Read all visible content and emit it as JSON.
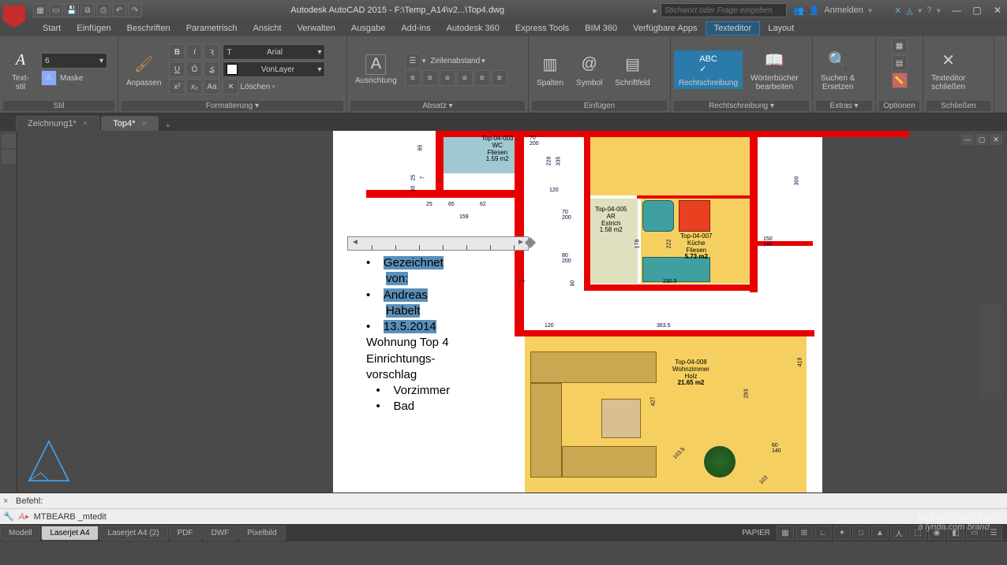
{
  "titlebar": {
    "app_title": "Autodesk AutoCAD 2015 - F:\\Temp_A14\\v2...\\Top4.dwg",
    "search_placeholder": "Stichwort oder Frage eingeben",
    "signin": "Anmelden"
  },
  "menu": {
    "items": [
      "Start",
      "Einfügen",
      "Beschriften",
      "Parametrisch",
      "Ansicht",
      "Verwalten",
      "Ausgabe",
      "Add-ins",
      "Autodesk 360",
      "Express Tools",
      "BIM 360",
      "Verfügbare Apps",
      "Texteditor",
      "Layout"
    ],
    "active_index": 12
  },
  "ribbon": {
    "stil": {
      "label": "Stil",
      "textstil": "Text-\nstil",
      "height": "6",
      "mask": "Maske"
    },
    "formatierung": {
      "label": "Formatierung ▾",
      "anpassen": "Anpassen",
      "font": "Arial",
      "layer": "VonLayer",
      "loeschen": "Löschen"
    },
    "absatz": {
      "label": "Absatz ▾",
      "ausrichtung": "Ausrichtung",
      "zeilenabstand": "Zeilenabstand"
    },
    "einfuegen": {
      "label": "Einfügen",
      "spalten": "Spalten",
      "symbol": "Symbol",
      "schriftfeld": "Schriftfeld"
    },
    "rechtschreibung": {
      "label": "Rechtschreibung ▾",
      "rs": "Rechtschreibung",
      "woerterbuecher": "Wörterbücher\nbearbeiten"
    },
    "extras": {
      "label": "Extras ▾",
      "suchen": "Suchen &\nErsetzen"
    },
    "optionen": {
      "label": "Optionen"
    },
    "schliessen": {
      "label": "Schließen",
      "texteditor": "Texteditor\nschließen"
    }
  },
  "doc_tabs": {
    "tabs": [
      {
        "label": "Zeichnung1*",
        "active": false
      },
      {
        "label": "Top4*",
        "active": true
      }
    ]
  },
  "text_editor": {
    "line1": "Gezeichnet",
    "line2": "von:",
    "line3": "Andreas",
    "line4": "Habelt",
    "line5": "13.5.2014",
    "line6": "Wohnung Top 4",
    "line7": "Einrichtungs-",
    "line8": "vorschlag",
    "sub1": "Vorzimmer",
    "sub2": "Bad"
  },
  "rooms": {
    "wc": {
      "id": "Top-04-003",
      "name": "WC",
      "floor": "Fliesen",
      "area": "1.59 m2"
    },
    "ar": {
      "id": "Top-04-005",
      "name": "AR",
      "floor": "Estrich",
      "area": "1.58 m2"
    },
    "kueche": {
      "id": "Top-04-007",
      "name": "Küche",
      "floor": "Fliesen",
      "area": "5.73 m2"
    },
    "wohnzimmer": {
      "id": "Top-04-008",
      "name": "Wohnzimmer",
      "floor": "Holz",
      "area": "21.65 m2"
    }
  },
  "dims": {
    "d1": "85",
    "d2": "25",
    "d3": "30",
    "d4": "7",
    "d5": "25",
    "d6": "65",
    "d7": "62",
    "d8": "159",
    "d9": "70",
    "d10": "200",
    "d11": "120",
    "d12": "70",
    "d13": "200",
    "d14": "80",
    "d15": "200",
    "d16": "90",
    "d17": "228",
    "d18": "335",
    "d19": "178",
    "d20": "222",
    "d21": "230.5",
    "d22": "150",
    "d23": "140",
    "d24": "300",
    "d25": "120",
    "d26": "363.5",
    "d27": "427",
    "d28": "293",
    "d29": "419",
    "d30": "103.5",
    "d31": "60",
    "d32": "140",
    "d33": "103"
  },
  "command": {
    "prompt": "Befehl:",
    "current": "MTBEARB _mtedit"
  },
  "status": {
    "tabs": [
      "Modell",
      "Laserjet A4",
      "Laserjet A4 (2)",
      "PDF",
      "DWF",
      "Pixelbild"
    ],
    "active_index": 1,
    "paper": "PAPIER"
  },
  "watermark": {
    "l1": "video2brain.com",
    "l2": "a lynda.com brand"
  }
}
